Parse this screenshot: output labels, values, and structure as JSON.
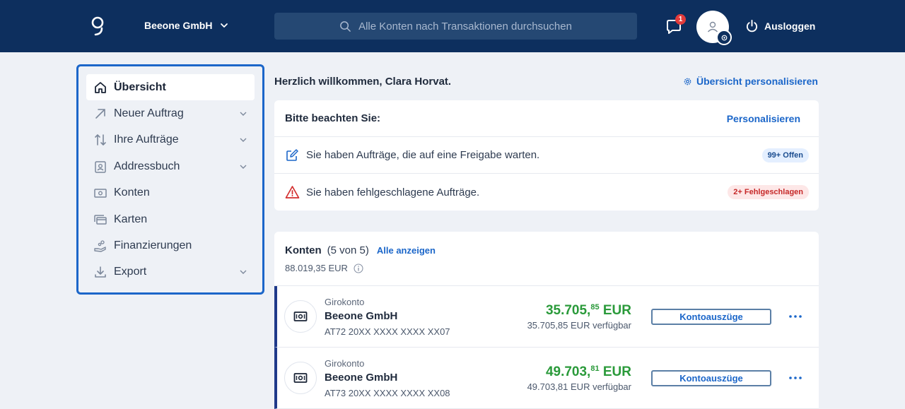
{
  "header": {
    "company": "Beeone GmbH",
    "search_placeholder": "Alle Konten nach Transaktionen durchsuchen",
    "notifications_count": "1",
    "logout_label": "Ausloggen"
  },
  "sidebar": {
    "items": [
      {
        "label": "Übersicht",
        "icon": "home-icon",
        "active": true,
        "expandable": false
      },
      {
        "label": "Neuer Auftrag",
        "icon": "arrow-up-right-icon",
        "active": false,
        "expandable": true
      },
      {
        "label": "Ihre Aufträge",
        "icon": "transfer-arrows-icon",
        "active": false,
        "expandable": true
      },
      {
        "label": "Addressbuch",
        "icon": "contact-card-icon",
        "active": false,
        "expandable": true
      },
      {
        "label": "Konten",
        "icon": "banknote-icon",
        "active": false,
        "expandable": false
      },
      {
        "label": "Karten",
        "icon": "cards-icon",
        "active": false,
        "expandable": false
      },
      {
        "label": "Finanzierungen",
        "icon": "hand-coins-icon",
        "active": false,
        "expandable": false
      },
      {
        "label": "Export",
        "icon": "download-icon",
        "active": false,
        "expandable": true
      }
    ]
  },
  "main": {
    "welcome": "Herzlich willkommen, Clara Horvat.",
    "personalize_overview": "Übersicht personalisieren",
    "notice": {
      "title": "Bitte beachten Sie:",
      "personalize": "Personalisieren",
      "rows": [
        {
          "text": "Sie haben Aufträge, die auf eine Freigabe warten.",
          "badge": "99+ Offen",
          "icon": "edit-icon"
        },
        {
          "text": "Sie haben fehlgeschlagene Aufträge.",
          "badge": "2+ Fehlgeschlagen",
          "icon": "warning-icon"
        }
      ]
    },
    "accounts": {
      "title": "Konten",
      "count": "(5 von 5)",
      "show_all": "Alle anzeigen",
      "total": "88.019,35 EUR",
      "items": [
        {
          "type": "Girokonto",
          "name": "Beeone GmbH",
          "iban": "AT72 20XX XXXX XXXX XX07",
          "amount_main": "35.705,",
          "amount_cents": "85",
          "currency": " EUR",
          "available": "35.705,85 EUR verfügbar",
          "button": "Kontoauszüge"
        },
        {
          "type": "Girokonto",
          "name": "Beeone GmbH",
          "iban": "AT73 20XX XXXX XXXX XX08",
          "amount_main": "49.703,",
          "amount_cents": "81",
          "currency": " EUR",
          "available": "49.703,81 EUR verfügbar",
          "button": "Kontoauszüge"
        }
      ]
    }
  },
  "colors": {
    "header_bg": "#0d2f5e",
    "accent": "#1b66c9",
    "positive_amount": "#2a9a3a",
    "badge_red": "#e23b3b"
  }
}
